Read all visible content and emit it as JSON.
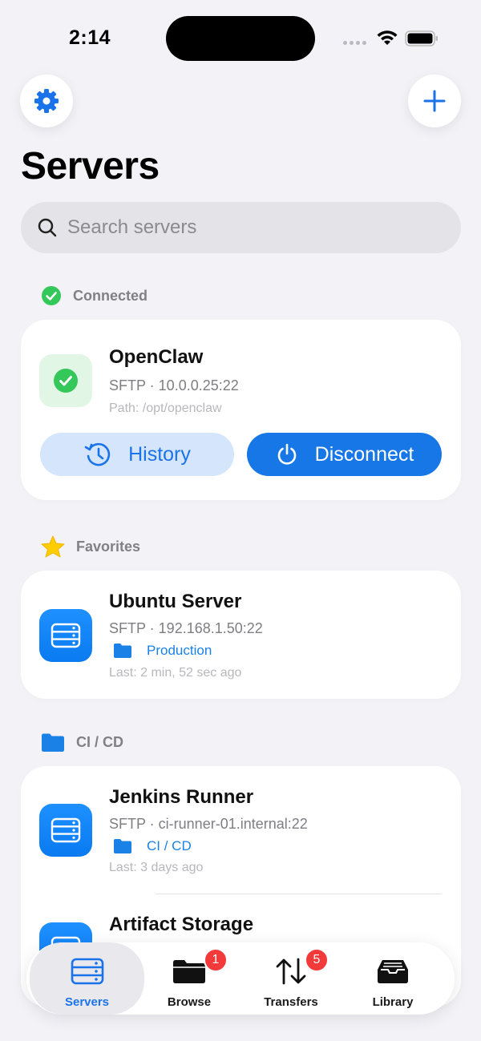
{
  "status_bar": {
    "time": "2:14"
  },
  "header": {
    "title": "Servers"
  },
  "search": {
    "placeholder": "Search servers"
  },
  "connected": {
    "section_label": "Connected",
    "server": {
      "name": "OpenClaw",
      "protocol_host": "SFTP · 10.0.0.25:22",
      "path": "Path: /opt/openclaw",
      "history_label": "History",
      "disconnect_label": "Disconnect"
    }
  },
  "favorites": {
    "section_label": "Favorites",
    "servers": [
      {
        "name": "Ubuntu Server",
        "protocol_host": "SFTP · 192.168.1.50:22",
        "tag": "Production",
        "last": "Last: 2 min, 52 sec ago"
      }
    ]
  },
  "cicd": {
    "section_label": "CI / CD",
    "servers": [
      {
        "name": "Jenkins Runner",
        "protocol_host": "SFTP · ci-runner-01.internal:22",
        "tag": "CI / CD",
        "last": "Last: 3 days ago"
      },
      {
        "name": "Artifact Storage"
      }
    ]
  },
  "tabbar": {
    "tabs": [
      {
        "label": "Servers",
        "icon": "server-icon",
        "active": true
      },
      {
        "label": "Browse",
        "icon": "folder-icon",
        "badge": "1"
      },
      {
        "label": "Transfers",
        "icon": "transfer-arrows-icon",
        "badge": "5"
      },
      {
        "label": "Library",
        "icon": "tray-icon"
      }
    ]
  },
  "colors": {
    "accent": "#1a73e8",
    "connected_green": "#34c759",
    "badge_red": "#f23a3a",
    "favorite_star": "#ffcc00"
  }
}
